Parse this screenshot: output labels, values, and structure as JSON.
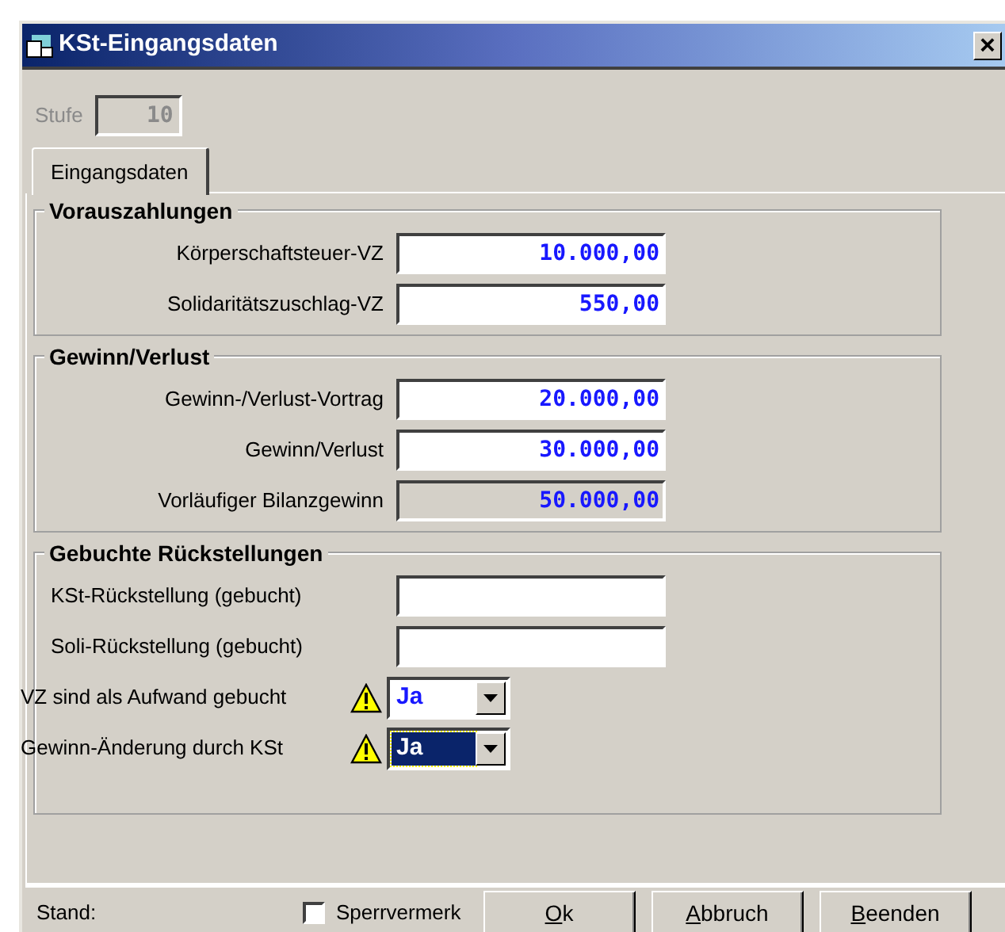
{
  "window": {
    "title": "KSt-Eingangsdaten",
    "close": "×"
  },
  "stufe": {
    "label": "Stufe",
    "value": "10",
    "disabled": true
  },
  "tabs": [
    {
      "label": "Eingangsdaten",
      "selected": true
    }
  ],
  "groups": [
    {
      "title": "Vorauszahlungen",
      "items": [
        {
          "kind": "field",
          "label": "Körperschaftsteuer-VZ",
          "value": "10.000,00",
          "disabled": false
        },
        {
          "kind": "field",
          "label": "Solidaritätszuschlag-VZ",
          "value": "550,00",
          "disabled": false
        }
      ]
    },
    {
      "title": "Gewinn/Verlust",
      "items": [
        {
          "kind": "field",
          "label": "Gewinn-/Verlust-Vortrag",
          "value": "20.000,00",
          "disabled": false
        },
        {
          "kind": "field",
          "label": "Gewinn/Verlust",
          "value": "30.000,00",
          "disabled": false
        },
        {
          "kind": "field",
          "label": "Vorläufiger Bilanzgewinn",
          "value": "50.000,00",
          "disabled": true
        }
      ]
    },
    {
      "title": "Gebuchte Rückstellungen",
      "items": [
        {
          "kind": "field",
          "label": "KSt-Rückstellung (gebucht)",
          "disabled": false
        },
        {
          "kind": "field",
          "label": "Soli-Rückstellung (gebucht)",
          "disabled": false
        },
        {
          "kind": "combo",
          "label": "VZ sind als Aufwand gebucht",
          "value": "Ja",
          "warning": true,
          "focused": false
        },
        {
          "kind": "combo",
          "label": "Gewinn-Änderung durch KSt",
          "value": "Ja",
          "warning": true,
          "focused": true
        }
      ]
    }
  ],
  "status": {
    "label": "Stand:"
  },
  "lock": {
    "label": "Sperrvermerk",
    "checked": false
  },
  "buttons": [
    "Ok",
    "Abbruch",
    "Beenden"
  ]
}
